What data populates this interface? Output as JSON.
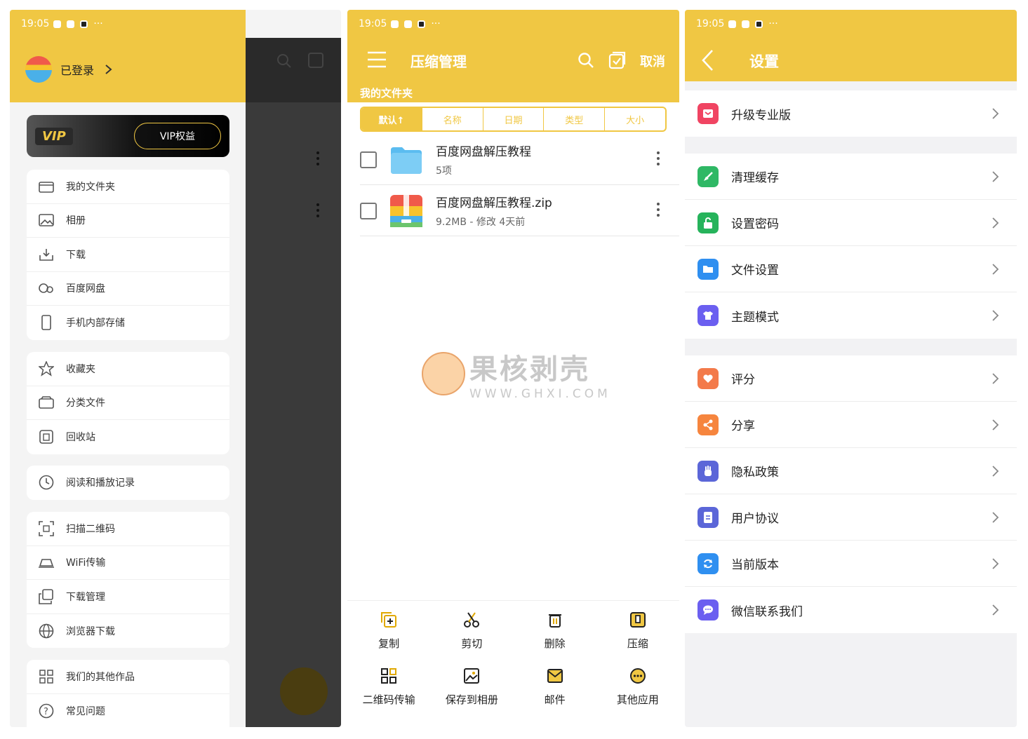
{
  "status": {
    "time": "19:05",
    "more": "···"
  },
  "drawer": {
    "login_label": "已登录",
    "vip_logo": "VIP",
    "vip_button": "VIP权益",
    "group1": [
      "我的文件夹",
      "相册",
      "下载",
      "百度网盘",
      "手机内部存储"
    ],
    "group2": [
      "收藏夹",
      "分类文件",
      "回收站"
    ],
    "group3": [
      "阅读和播放记录"
    ],
    "group4": [
      "扫描二维码",
      "WiFi传输",
      "下载管理",
      "浏览器下载"
    ],
    "group5": [
      "我们的其他作品",
      "常见问题"
    ]
  },
  "compress": {
    "title": "压缩管理",
    "cancel": "取消",
    "subtitle": "我的文件夹",
    "sort_tabs": [
      "默认↑",
      "名称",
      "日期",
      "类型",
      "大小"
    ],
    "files": [
      {
        "name": "百度网盘解压教程",
        "meta": "5项"
      },
      {
        "name": "百度网盘解压教程.zip",
        "meta": "9.2MB - 修改 4天前"
      }
    ],
    "watermark": {
      "main": "果核剥壳",
      "url": "WWW.GHXI.COM"
    },
    "actions": [
      "复制",
      "剪切",
      "删除",
      "压缩",
      "二维码传输",
      "保存到相册",
      "邮件",
      "其他应用"
    ]
  },
  "settings": {
    "title": "设置",
    "group1": [
      {
        "label": "升级专业版",
        "color": "#f04462"
      }
    ],
    "group2": [
      {
        "label": "清理缓存",
        "color": "#2fb865"
      },
      {
        "label": "设置密码",
        "color": "#26b35b"
      },
      {
        "label": "文件设置",
        "color": "#2f8ff0"
      },
      {
        "label": "主题模式",
        "color": "#6b5ff0"
      }
    ],
    "group3": [
      {
        "label": "评分",
        "color": "#f37a4a"
      },
      {
        "label": "分享",
        "color": "#f6853e"
      },
      {
        "label": "隐私政策",
        "color": "#5b66d8"
      },
      {
        "label": "用户协议",
        "color": "#5b66d8"
      },
      {
        "label": "当前版本",
        "color": "#2f8ff0"
      },
      {
        "label": "微信联系我们",
        "color": "#6b5ff0"
      }
    ]
  }
}
